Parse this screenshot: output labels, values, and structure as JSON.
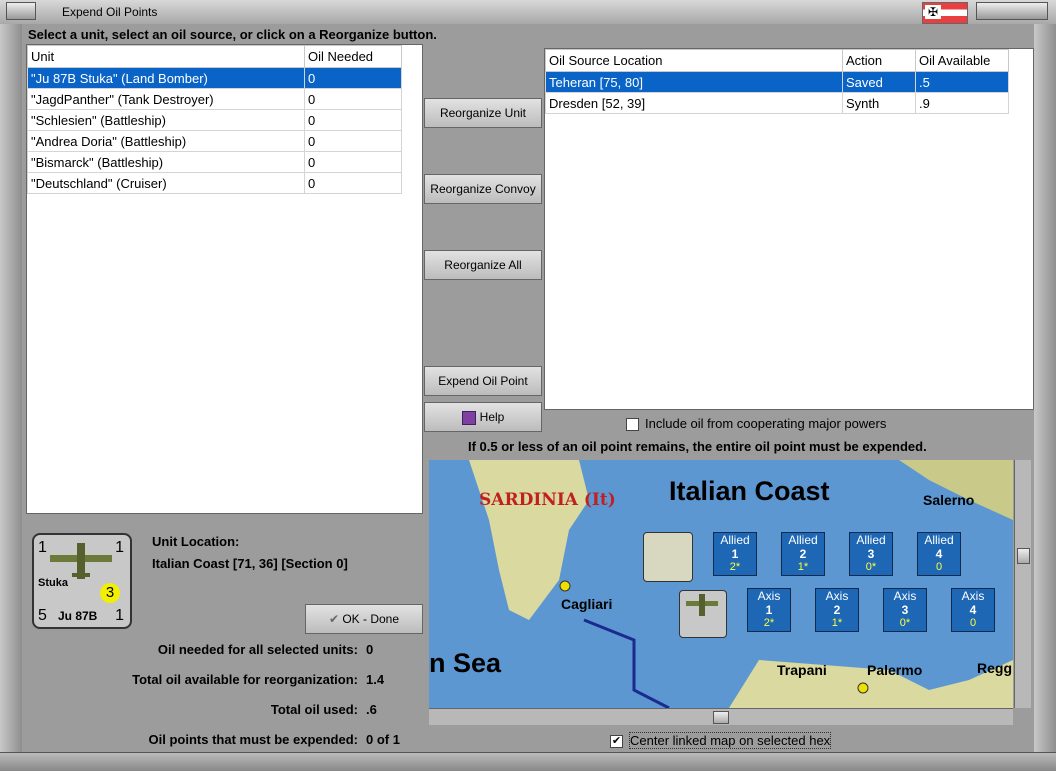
{
  "window": {
    "title": "Expend Oil Points"
  },
  "instruction": "Select a unit, select an oil source, or click on a Reorganize button.",
  "units_table": {
    "headers": [
      "Unit",
      "Oil Needed"
    ],
    "rows": [
      {
        "unit": "\"Ju 87B Stuka\" (Land Bomber)",
        "oil": "0",
        "selected": true
      },
      {
        "unit": "\"JagdPanther\" (Tank Destroyer)",
        "oil": "0"
      },
      {
        "unit": "\"Schlesien\" (Battleship)",
        "oil": "0"
      },
      {
        "unit": "\"Andrea Doria\" (Battleship)",
        "oil": "0"
      },
      {
        "unit": "\"Bismarck\" (Battleship)",
        "oil": "0"
      },
      {
        "unit": "\"Deutschland\" (Cruiser)",
        "oil": "0"
      }
    ]
  },
  "buttons": {
    "reorganize_unit": "Reorganize Unit",
    "reorganize_convoy": "Reorganize Convoy",
    "reorganize_all": "Reorganize All",
    "expend_oil_point": "Expend Oil Point",
    "help": "Help",
    "ok_done": "OK - Done"
  },
  "sources_table": {
    "headers": [
      "Oil Source Location",
      "Action",
      "Oil Available"
    ],
    "rows": [
      {
        "location": "Teheran [75, 80]",
        "action": "Saved",
        "available": ".5",
        "selected": true
      },
      {
        "location": "Dresden [52, 39]",
        "action": "Synth",
        "available": ".9"
      }
    ]
  },
  "include_cooperating": "Include oil from cooperating major powers",
  "rule_note": "If 0.5 or less of an oil point remains, the entire oil point must be expended.",
  "unit_info": {
    "location_label": "Unit Location:",
    "location_value": "Italian Coast [71, 36] [Section 0]",
    "counter": {
      "top_left": "1",
      "top_right": "1",
      "name": "Stuka",
      "badge": "3",
      "bottom_left": "5",
      "model": "Ju 87B",
      "bottom_right": "1"
    }
  },
  "stats": [
    {
      "label": "Oil needed for all selected units:",
      "value": "0"
    },
    {
      "label": "Total oil available for reorganization:",
      "value": "1.4"
    },
    {
      "label": "Total oil used:",
      "value": ".6"
    },
    {
      "label": "Oil points that must be expended:",
      "value": "0 of 1"
    }
  ],
  "map": {
    "region_title": "Italian Coast",
    "sardinia": "SARDINIA (It)",
    "sea": "n Sea",
    "cities": [
      "Cagliari",
      "Salerno",
      "Trapani",
      "Palermo",
      "Regg"
    ],
    "allied_boxes": [
      {
        "label": "Allied",
        "num": "1",
        "sub": "2*"
      },
      {
        "label": "Allied",
        "num": "2",
        "sub": "1*"
      },
      {
        "label": "Allied",
        "num": "3",
        "sub": "0*"
      },
      {
        "label": "Allied",
        "num": "4",
        "sub": "0"
      }
    ],
    "axis_boxes": [
      {
        "label": "Axis",
        "num": "1",
        "sub": "2*"
      },
      {
        "label": "Axis",
        "num": "2",
        "sub": "1*"
      },
      {
        "label": "Axis",
        "num": "3",
        "sub": "0*"
      },
      {
        "label": "Axis",
        "num": "4",
        "sub": "0"
      }
    ]
  },
  "center_linked": "Center linked map on selected hex",
  "colors": {
    "selection": "#0a64c8",
    "sea": "#5d97d2",
    "land": "#d9d9a0",
    "box": "#1d67b5"
  }
}
